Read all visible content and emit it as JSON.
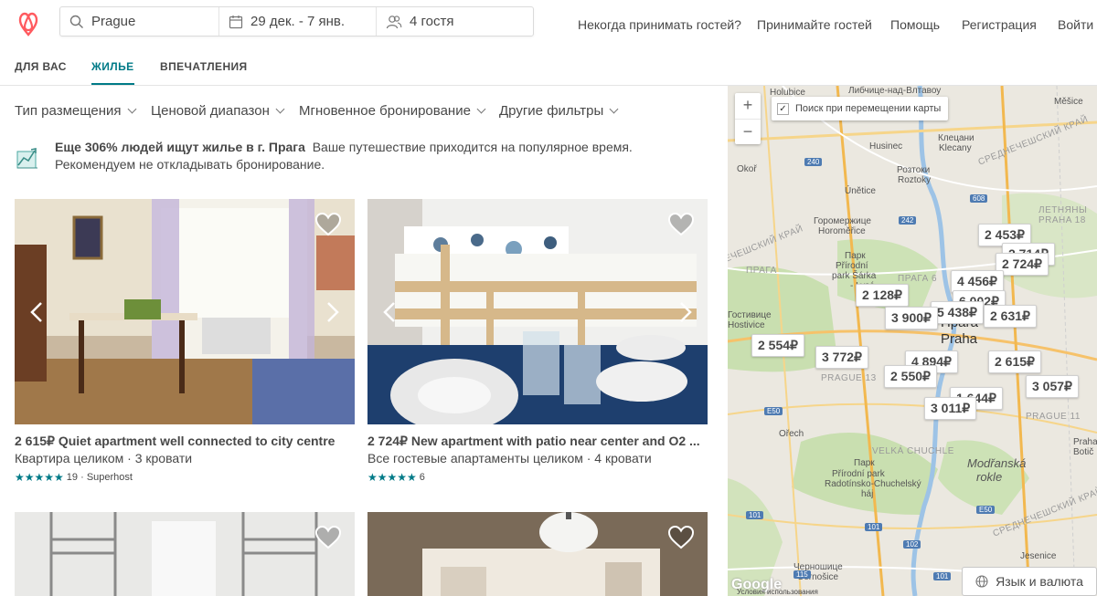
{
  "search": {
    "location": "Prague",
    "dates": "29 дек. - 7 янв.",
    "guests": "4 гостя"
  },
  "nav": {
    "never_host": "Некогда принимать гостей?",
    "host": "Принимайте гостей",
    "help": "Помощь",
    "signup": "Регистрация",
    "login": "Войти"
  },
  "tabs": [
    {
      "label": "ДЛЯ ВАС"
    },
    {
      "label": "ЖИЛЬЕ"
    },
    {
      "label": "ВПЕЧАТЛЕНИЯ"
    }
  ],
  "filters": [
    {
      "label": "Тип размещения"
    },
    {
      "label": "Ценовой диапазон"
    },
    {
      "label": "Мгновенное бронирование"
    },
    {
      "label": "Другие фильтры"
    }
  ],
  "notice": {
    "headline": "Еще 306% людей ищут жилье в г. Прага",
    "text1": "Ваше путешествие приходится на популярное время.",
    "text2": "Рекомендуем не откладывать бронирование."
  },
  "listings": [
    {
      "title": "2 615₽ Quiet apartment well connected to city centre",
      "sub": "Квартира целиком · 3 кровати",
      "stars": "★★★★★",
      "reviews": "19",
      "badge": "· Superhost"
    },
    {
      "title": "2 724₽ New apartment with patio near center and O2 ...",
      "sub": "Все гостевые апартаменты целиком · 4 кровати",
      "stars": "★★★★★",
      "reviews": "6",
      "badge": ""
    }
  ],
  "map": {
    "search_toggle": "Поиск при перемещении карты",
    "zoom_in": "+",
    "zoom_out": "−",
    "pins": [
      "2 453₽",
      "2 714₽",
      "2 724₽",
      "4 456₽",
      "2 128₽",
      "6 002₽",
      "5 438₽",
      "3 900₽",
      "2 631₽",
      "2 554₽",
      "3 772₽",
      "4 894₽",
      "2 615₽",
      "2 550₽",
      "3 057₽",
      "1 644₽",
      "3 011₽"
    ],
    "places": {
      "holubice": "Holubice",
      "libcice": "Либчице-над-Влтавоу",
      "mesice": "Měšice",
      "husinec": "Husinec",
      "klecany1": "Клецани",
      "klecany2": "Klecany",
      "okor": "Okoř",
      "roztoky1": "Розтоки",
      "roztoky2": "Roztoky",
      "unetice": "Únětice",
      "horomerice1": "Горомержице",
      "horomerice2": "Horoměřice",
      "letnany1": "ЛЕТНЯНЫ",
      "letnany2": "PRAHA 18",
      "praha_small": "ПРАГА",
      "park1": "Парк",
      "park2": "Přírodní",
      "park3": "park Šárka",
      "park4": "- Lysá",
      "praha6": "ПРАГА 6",
      "hostivice1": "Гостивице",
      "hostivice2": "Hostivice",
      "praga_big": "Прага",
      "praha_big": "Praha",
      "praha13": "PRAGUE 13",
      "praha11": "PRAGUE 11",
      "orech": "Ořech",
      "velka": "VELKÁ CHUCHLE",
      "park5": "Парк",
      "park6": "Přírodní park",
      "park7": "Radotínsko-Chuchelský",
      "park8": "háj",
      "modranska1": "Modřanská",
      "modranska2": "rokle",
      "cernosice1": "Черношице",
      "cernosice2": "Černošice",
      "jesenice": "Jesenice",
      "praha_b": "Praha",
      "botic": "Botič",
      "stredo": "СРЕДНЕЧЕШСКИЙ КРАЙ",
      "stredo2": "СРЕДНЕЧЕШСКИЙ КРАЙ",
      "zapad": "ЕЧЕШСКИЙ КРАЙ"
    },
    "roads": [
      "240",
      "608",
      "242",
      "E50",
      "101",
      "E50",
      "101",
      "115",
      "102",
      "101"
    ],
    "google": "Google",
    "terms": "Условия использования"
  },
  "language_button": "Язык и валюта"
}
